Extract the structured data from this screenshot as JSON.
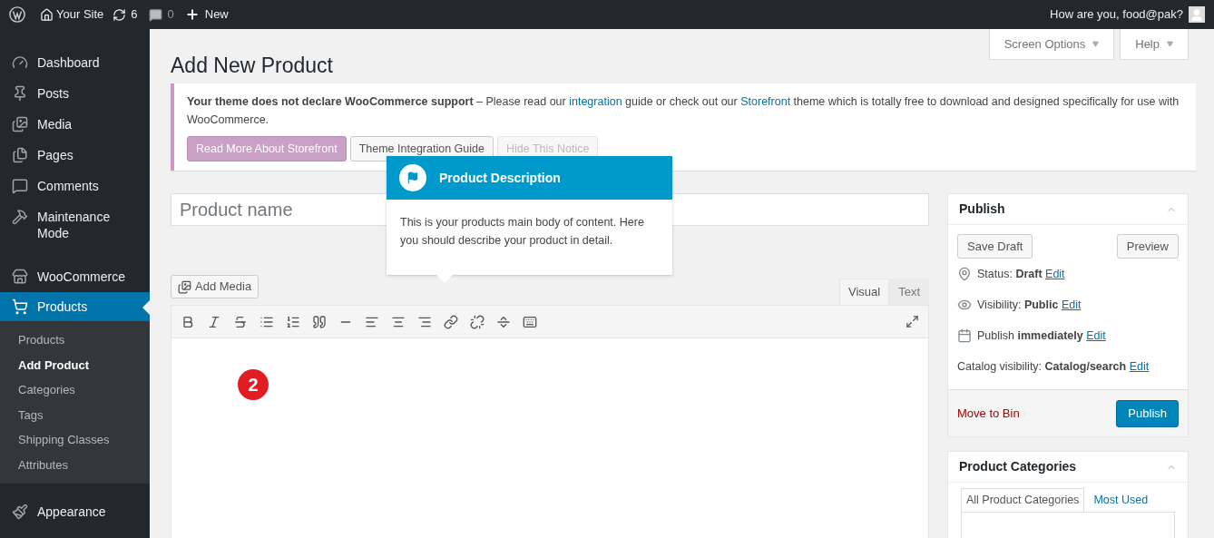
{
  "admin_bar": {
    "site": "Your Site",
    "updates": "6",
    "comments": "0",
    "new": "New",
    "greeting": "How are you, food@pak?"
  },
  "sidebar": {
    "items": [
      {
        "label": "Dashboard",
        "selected": false
      },
      {
        "label": "Posts",
        "selected": false
      },
      {
        "label": "Media",
        "selected": false
      },
      {
        "label": "Pages",
        "selected": false
      },
      {
        "label": "Comments",
        "selected": false
      },
      {
        "label": "Maintenance Mode",
        "selected": false
      },
      {
        "label": "WooCommerce",
        "selected": false
      },
      {
        "label": "Products",
        "selected": true,
        "children": [
          {
            "label": "Products",
            "selected": false
          },
          {
            "label": "Add Product",
            "selected": true
          },
          {
            "label": "Categories",
            "selected": false
          },
          {
            "label": "Tags",
            "selected": false
          },
          {
            "label": "Shipping Classes",
            "selected": false
          },
          {
            "label": "Attributes",
            "selected": false
          }
        ]
      },
      {
        "label": "Appearance",
        "selected": false
      }
    ]
  },
  "screen_tabs": [
    "Screen Options",
    "Help"
  ],
  "page_title": "Add New Product",
  "notice": {
    "text": "**Your theme does not declare WooCommerce support** – Please read our ",
    "link1": "integration",
    "text2": " guide or check out our ",
    "link2": "Storefront",
    "text3": " theme which is totally free to download and designed specifically for use with WooCommerce.",
    "buttons": [
      {
        "label": "Read More About Storefront",
        "kind": "primary"
      },
      {
        "label": "Theme Integration Guide",
        "kind": "default"
      },
      {
        "label": "Hide This Notice",
        "kind": "disabled"
      }
    ]
  },
  "title_field": {
    "placeholder": "Product name"
  },
  "add_media": "Add Media",
  "editor_tabs": [
    {
      "label": "Visual",
      "selected": true
    },
    {
      "label": "Text",
      "selected": false
    }
  ],
  "step_marker": "2",
  "tooltip": {
    "title": "Product Description",
    "body": "This is your products main body of content. Here you should describe your product in detail."
  },
  "publish_box": {
    "title": "Publish",
    "save_draft": "Save Draft",
    "preview": "Preview",
    "rows": [
      {
        "kind": "status",
        "label": "Status: ",
        "value": "Draft",
        "link": "Edit"
      },
      {
        "kind": "visibility",
        "label": "Visibility: ",
        "value": "Public",
        "link": "Edit"
      },
      {
        "kind": "schedule",
        "label": "Publish ",
        "value": "immediately",
        "link": "Edit"
      },
      {
        "kind": "catalog",
        "label": "Catalog visibility: ",
        "value": "Catalog/search",
        "link": "Edit"
      }
    ],
    "trash": "Move to Bin",
    "publish": "Publish"
  },
  "categories_box": {
    "title": "Product Categories",
    "tabs": [
      {
        "label": "All Product Categories",
        "selected": true
      },
      {
        "label": "Most Used",
        "selected": false
      }
    ]
  }
}
